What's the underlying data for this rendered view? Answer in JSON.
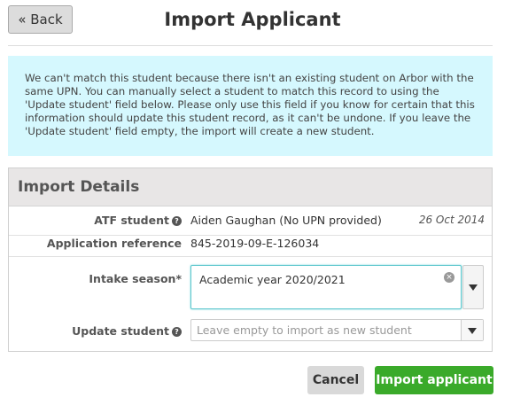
{
  "header": {
    "back_label": "« Back",
    "title": "Import Applicant"
  },
  "notice": {
    "text": "We can't match this student because there isn't an existing student on Arbor with the same UPN. You can manually select a student to match this record to using the 'Update student' field below. Please only use this field if you know for certain that this information should update this student record, as it can't be undone. If you leave the 'Update student' field empty, the import will create a new student."
  },
  "details": {
    "title": "Import Details",
    "atf_label": "ATF student",
    "atf_value": "Aiden Gaughan (No UPN provided)",
    "atf_date": "26 Oct 2014",
    "app_ref_label": "Application reference",
    "app_ref_value": "845-2019-09-E-126034",
    "intake_label": "Intake season",
    "intake_required": "*",
    "intake_value": "Academic year 2020/2021",
    "update_label": "Update student",
    "update_placeholder": "Leave empty to import as new student"
  },
  "actions": {
    "cancel_label": "Cancel",
    "import_label": "Import applicant"
  },
  "icons": {
    "help": "question-circle-icon",
    "clear": "close-circle-icon",
    "dropdown": "caret-down-icon"
  },
  "colors": {
    "notice_bg": "#d5f8fe",
    "primary_button": "#3aaa2a",
    "focus_border": "#5bc6cc"
  }
}
